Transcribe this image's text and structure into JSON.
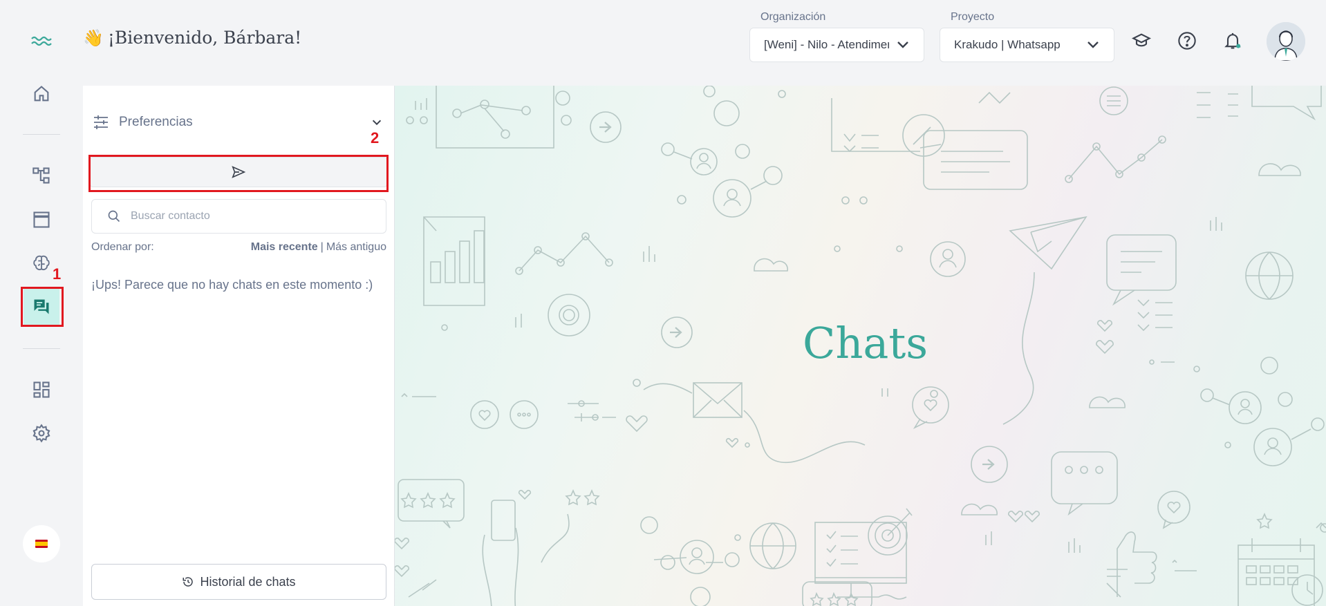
{
  "header": {
    "welcome": "¡Bienvenido, Bárbara!",
    "wave_emoji": "👋",
    "organization_label": "Organización",
    "organization_value": "[Weni] - Nilo - Atendimento",
    "project_label": "Proyecto",
    "project_value": "Krakudo | Whatsapp",
    "icons": [
      "graduation-cap-icon",
      "help-icon",
      "bell-icon"
    ]
  },
  "rail": {
    "items": [
      "home-icon",
      "flows-icon",
      "browser-icon",
      "brain-icon",
      "chats-icon",
      "dashboard-icon",
      "settings-icon"
    ],
    "active": "chats-icon",
    "lang": "es"
  },
  "annotations": {
    "one": "1",
    "two": "2",
    "color": "#e1181f"
  },
  "sidebar": {
    "preferences_label": "Preferencias",
    "search_placeholder": "Buscar contacto",
    "order_label": "Ordenar por:",
    "order_recent": "Mais recente",
    "order_separator": "|",
    "order_oldest": "Más antiguo",
    "empty_message": "¡Ups! Parece que no hay chats en este momento :)",
    "history_label": "Historial de chats"
  },
  "main": {
    "title": "Chats",
    "accent": "#3ba89a"
  }
}
